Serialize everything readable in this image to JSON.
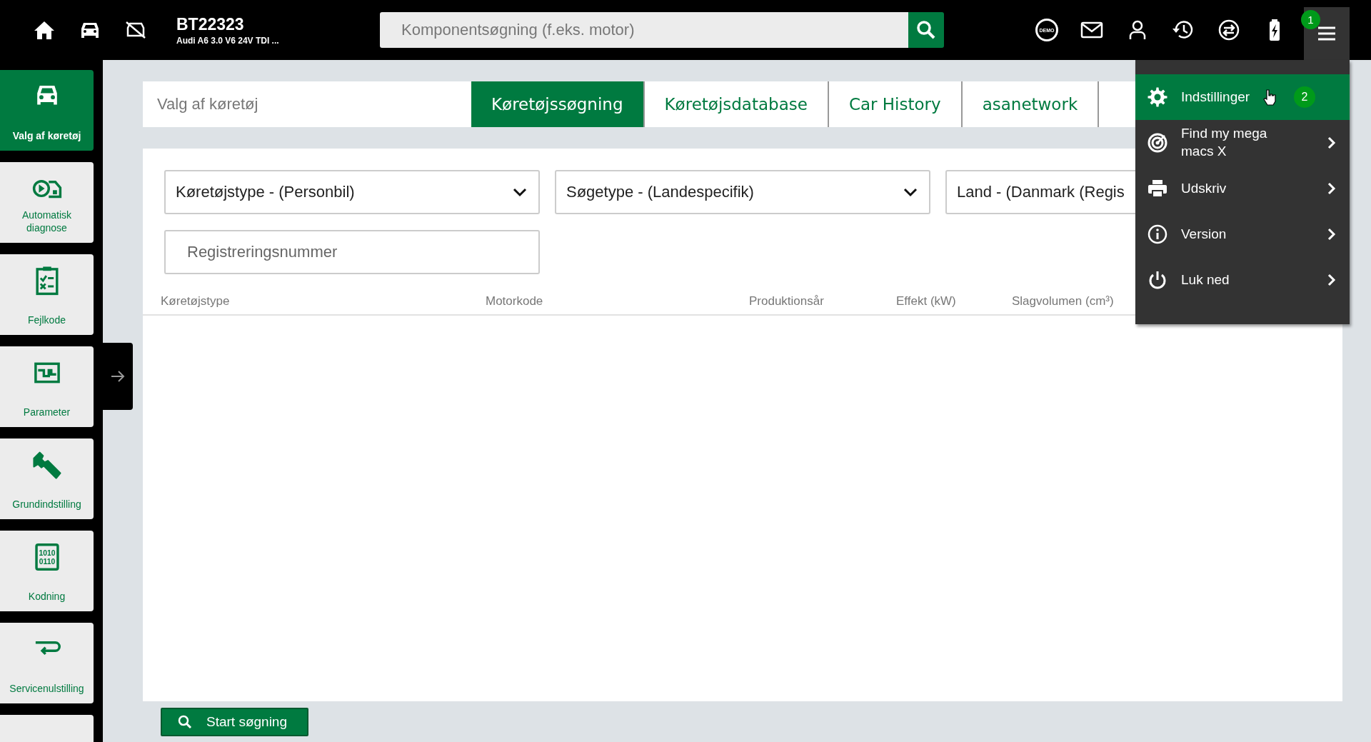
{
  "top_bar": {
    "vehicle_id": "BT22323",
    "vehicle_name": "Audi A6 3.0 V6 24V TDI ...",
    "search": {
      "placeholder": "Komponentsøgning (f.eks. motor)"
    },
    "demo_label": "DEMO",
    "menu_badge": "1"
  },
  "sidebar": {
    "items": [
      {
        "label": "Valg af køretøj",
        "kind": "car",
        "selected": true
      },
      {
        "label": "Automatisk diagnose",
        "kind": "diagnose",
        "selected": false
      },
      {
        "label": "Fejlkode",
        "kind": "checklist",
        "selected": false
      },
      {
        "label": "Parameter",
        "kind": "parameter",
        "selected": false
      },
      {
        "label": "Grundindstilling",
        "kind": "wrench",
        "selected": false
      },
      {
        "label": "Kodning",
        "kind": "binary",
        "selected": false,
        "icon_text": [
          "1010",
          "0110"
        ]
      },
      {
        "label": "Servicenulstilling",
        "kind": "return",
        "selected": false
      }
    ]
  },
  "header": {
    "title": "Valg af køretøj",
    "tabs": [
      {
        "label": "Køretøjssøgning",
        "selected": true
      },
      {
        "label": "Køretøjsdatabase",
        "selected": false
      },
      {
        "label": "Car History",
        "selected": false
      },
      {
        "label": "asanetwork",
        "selected": false
      }
    ]
  },
  "filters": {
    "dropdowns": [
      {
        "label": "Køretøjstype - (Personbil)",
        "caret": true
      },
      {
        "label": "Søgetype - (Landespecifik)",
        "caret": true
      },
      {
        "label": "Land - (Danmark (Regis",
        "caret": false
      }
    ],
    "registration": {
      "placeholder": "Registreringsnummer"
    }
  },
  "table": {
    "columns": [
      "Køretøjstype",
      "Motorkode",
      "Produktionsår",
      "Effekt (kW)",
      "Slagvolumen (cm³)"
    ]
  },
  "start_button": "Start søgning",
  "menu": {
    "items": [
      {
        "label": "Indstillinger",
        "kind": "gear",
        "selected": true,
        "submenu": false,
        "badge": "2"
      },
      {
        "label": "Find my mega macs X",
        "kind": "target",
        "selected": false,
        "submenu": true
      },
      {
        "label": "Udskriv",
        "kind": "printer",
        "selected": false,
        "submenu": true
      },
      {
        "label": "Version",
        "kind": "info",
        "selected": false,
        "submenu": true
      },
      {
        "label": "Luk ned",
        "kind": "power",
        "selected": false,
        "submenu": true
      }
    ]
  }
}
